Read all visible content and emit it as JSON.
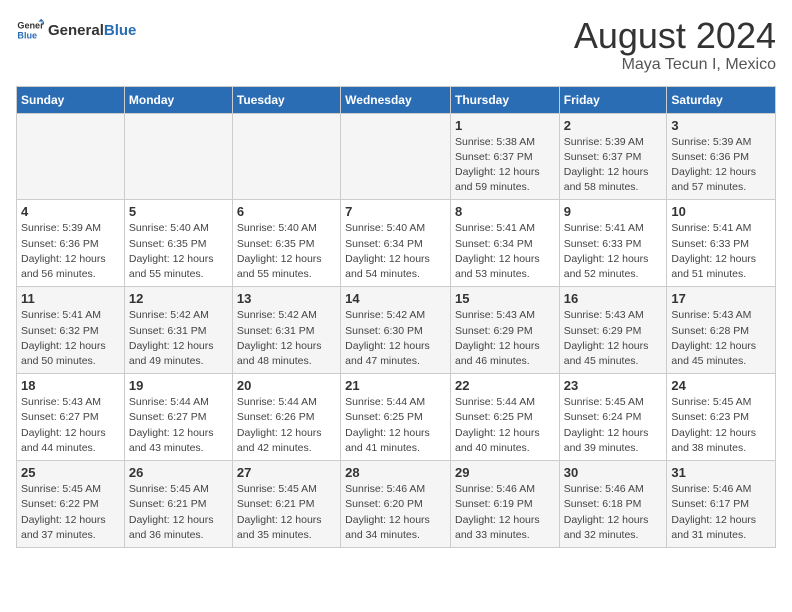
{
  "header": {
    "logo_general": "General",
    "logo_blue": "Blue",
    "title": "August 2024",
    "subtitle": "Maya Tecun I, Mexico"
  },
  "weekdays": [
    "Sunday",
    "Monday",
    "Tuesday",
    "Wednesday",
    "Thursday",
    "Friday",
    "Saturday"
  ],
  "weeks": [
    [
      {
        "day": "",
        "detail": ""
      },
      {
        "day": "",
        "detail": ""
      },
      {
        "day": "",
        "detail": ""
      },
      {
        "day": "",
        "detail": ""
      },
      {
        "day": "1",
        "detail": "Sunrise: 5:38 AM\nSunset: 6:37 PM\nDaylight: 12 hours\nand 59 minutes."
      },
      {
        "day": "2",
        "detail": "Sunrise: 5:39 AM\nSunset: 6:37 PM\nDaylight: 12 hours\nand 58 minutes."
      },
      {
        "day": "3",
        "detail": "Sunrise: 5:39 AM\nSunset: 6:36 PM\nDaylight: 12 hours\nand 57 minutes."
      }
    ],
    [
      {
        "day": "4",
        "detail": "Sunrise: 5:39 AM\nSunset: 6:36 PM\nDaylight: 12 hours\nand 56 minutes."
      },
      {
        "day": "5",
        "detail": "Sunrise: 5:40 AM\nSunset: 6:35 PM\nDaylight: 12 hours\nand 55 minutes."
      },
      {
        "day": "6",
        "detail": "Sunrise: 5:40 AM\nSunset: 6:35 PM\nDaylight: 12 hours\nand 55 minutes."
      },
      {
        "day": "7",
        "detail": "Sunrise: 5:40 AM\nSunset: 6:34 PM\nDaylight: 12 hours\nand 54 minutes."
      },
      {
        "day": "8",
        "detail": "Sunrise: 5:41 AM\nSunset: 6:34 PM\nDaylight: 12 hours\nand 53 minutes."
      },
      {
        "day": "9",
        "detail": "Sunrise: 5:41 AM\nSunset: 6:33 PM\nDaylight: 12 hours\nand 52 minutes."
      },
      {
        "day": "10",
        "detail": "Sunrise: 5:41 AM\nSunset: 6:33 PM\nDaylight: 12 hours\nand 51 minutes."
      }
    ],
    [
      {
        "day": "11",
        "detail": "Sunrise: 5:41 AM\nSunset: 6:32 PM\nDaylight: 12 hours\nand 50 minutes."
      },
      {
        "day": "12",
        "detail": "Sunrise: 5:42 AM\nSunset: 6:31 PM\nDaylight: 12 hours\nand 49 minutes."
      },
      {
        "day": "13",
        "detail": "Sunrise: 5:42 AM\nSunset: 6:31 PM\nDaylight: 12 hours\nand 48 minutes."
      },
      {
        "day": "14",
        "detail": "Sunrise: 5:42 AM\nSunset: 6:30 PM\nDaylight: 12 hours\nand 47 minutes."
      },
      {
        "day": "15",
        "detail": "Sunrise: 5:43 AM\nSunset: 6:29 PM\nDaylight: 12 hours\nand 46 minutes."
      },
      {
        "day": "16",
        "detail": "Sunrise: 5:43 AM\nSunset: 6:29 PM\nDaylight: 12 hours\nand 45 minutes."
      },
      {
        "day": "17",
        "detail": "Sunrise: 5:43 AM\nSunset: 6:28 PM\nDaylight: 12 hours\nand 45 minutes."
      }
    ],
    [
      {
        "day": "18",
        "detail": "Sunrise: 5:43 AM\nSunset: 6:27 PM\nDaylight: 12 hours\nand 44 minutes."
      },
      {
        "day": "19",
        "detail": "Sunrise: 5:44 AM\nSunset: 6:27 PM\nDaylight: 12 hours\nand 43 minutes."
      },
      {
        "day": "20",
        "detail": "Sunrise: 5:44 AM\nSunset: 6:26 PM\nDaylight: 12 hours\nand 42 minutes."
      },
      {
        "day": "21",
        "detail": "Sunrise: 5:44 AM\nSunset: 6:25 PM\nDaylight: 12 hours\nand 41 minutes."
      },
      {
        "day": "22",
        "detail": "Sunrise: 5:44 AM\nSunset: 6:25 PM\nDaylight: 12 hours\nand 40 minutes."
      },
      {
        "day": "23",
        "detail": "Sunrise: 5:45 AM\nSunset: 6:24 PM\nDaylight: 12 hours\nand 39 minutes."
      },
      {
        "day": "24",
        "detail": "Sunrise: 5:45 AM\nSunset: 6:23 PM\nDaylight: 12 hours\nand 38 minutes."
      }
    ],
    [
      {
        "day": "25",
        "detail": "Sunrise: 5:45 AM\nSunset: 6:22 PM\nDaylight: 12 hours\nand 37 minutes."
      },
      {
        "day": "26",
        "detail": "Sunrise: 5:45 AM\nSunset: 6:21 PM\nDaylight: 12 hours\nand 36 minutes."
      },
      {
        "day": "27",
        "detail": "Sunrise: 5:45 AM\nSunset: 6:21 PM\nDaylight: 12 hours\nand 35 minutes."
      },
      {
        "day": "28",
        "detail": "Sunrise: 5:46 AM\nSunset: 6:20 PM\nDaylight: 12 hours\nand 34 minutes."
      },
      {
        "day": "29",
        "detail": "Sunrise: 5:46 AM\nSunset: 6:19 PM\nDaylight: 12 hours\nand 33 minutes."
      },
      {
        "day": "30",
        "detail": "Sunrise: 5:46 AM\nSunset: 6:18 PM\nDaylight: 12 hours\nand 32 minutes."
      },
      {
        "day": "31",
        "detail": "Sunrise: 5:46 AM\nSunset: 6:17 PM\nDaylight: 12 hours\nand 31 minutes."
      }
    ]
  ]
}
